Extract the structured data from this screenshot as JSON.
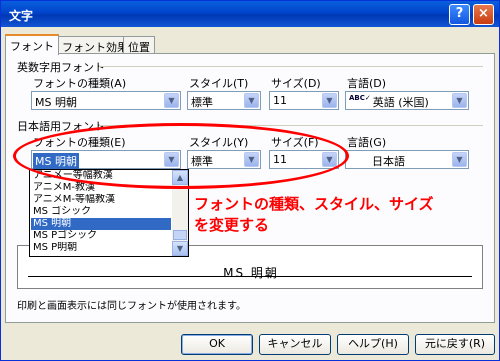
{
  "window": {
    "title": "文字",
    "help_glyph": "?",
    "close_glyph": "×"
  },
  "tabs": [
    {
      "label": "フォント"
    },
    {
      "label": "フォント効果"
    },
    {
      "label": "位置"
    }
  ],
  "western": {
    "group_label": "英数字用フォント",
    "font_label": "フォントの種類(A)",
    "font_value": "MS 明朝",
    "style_label": "スタイル(T)",
    "style_value": "標準",
    "size_label": "サイズ(D)",
    "size_value": "11",
    "language_label": "言語(D)",
    "language_value": "英語 (米国)",
    "language_icon": "abc-icon"
  },
  "asian": {
    "group_label": "日本語用フォント",
    "font_label": "フォントの種類(E)",
    "font_value": "MS 明朝",
    "style_label": "スタイル(Y)",
    "style_value": "標準",
    "size_label": "サイズ(F)",
    "size_value": "11",
    "language_label": "言語(G)",
    "language_value": "日本語"
  },
  "font_dropdown": {
    "items": [
      "アニメー等幅教漢",
      "アニメM-教漢",
      "アニメM-等幅教漢",
      "MS ゴシック",
      "MS 明朝",
      "MS Pゴシック",
      "MS P明朝"
    ],
    "selected": "MS 明朝"
  },
  "preview": {
    "text": "MS  明朝"
  },
  "note": "印刷と画面表示には同じフォントが使用されます。",
  "buttons": {
    "ok": "OK",
    "cancel": "キャンセル",
    "help": "ヘルプ(H)",
    "reset": "元に戻す(R)"
  },
  "annotation": {
    "line1": "フォントの種類、スタイル、サイズ",
    "line2": "を変更する",
    "color": "#ff0000"
  }
}
